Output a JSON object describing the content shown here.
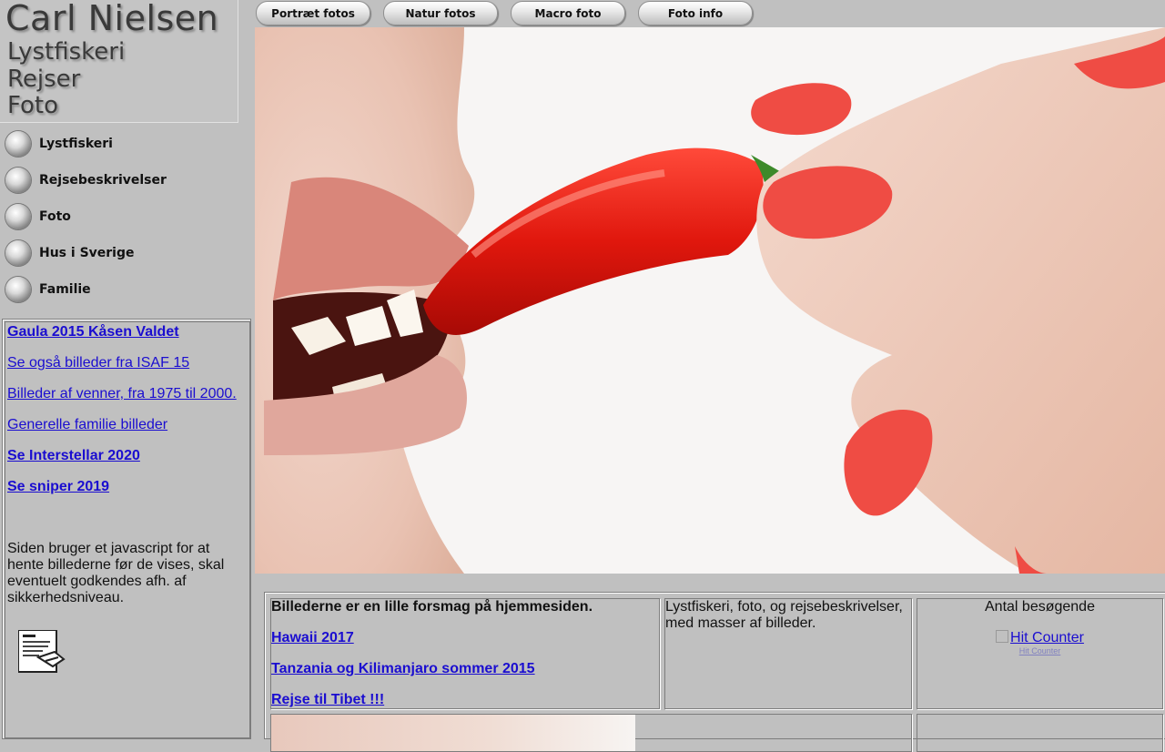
{
  "logo": {
    "title": "Carl Nielsen",
    "lines": [
      "Lystfiskeri",
      "Rejser",
      "Foto"
    ]
  },
  "top_nav": [
    "Portræt fotos",
    "Natur fotos",
    "Macro foto",
    "Foto info"
  ],
  "side_nav": [
    "Lystfiskeri",
    "Rejsebeskrivelser",
    "Foto",
    "Hus i Sverige",
    "Familie"
  ],
  "left_panel": {
    "links": [
      {
        "text": "Gaula 2015 Kåsen Valdet",
        "bold": true
      },
      {
        "text": "Se også billeder fra ISAF 15",
        "bold": false
      },
      {
        "text": "Billeder af venner, fra 1975 til 2000.",
        "bold": false
      },
      {
        "text": "Generelle familie billeder",
        "bold": false
      },
      {
        "text": "Se Interstellar 2020",
        "bold": true
      },
      {
        "text": "Se sniper 2019",
        "bold": true
      }
    ],
    "note": "Siden bruger et javascript for at hente billederne før de vises, skal eventuelt godkendes afh. af sikkerhedsniveau."
  },
  "hero": {
    "description_icon": "chili-pepper-photo"
  },
  "bottom": {
    "intro": "Billederne er en lille forsmag på hjemmesiden.",
    "links": [
      "Hawaii 2017",
      "Tanzania og Kilimanjaro sommer 2015",
      "Rejse til Tibet !!!"
    ],
    "description": "Lystfiskeri, foto, og rejsebeskrivelser, med masser af billeder.",
    "counter_label": "Antal besøgende",
    "counter_img_alt": "Hit Counter",
    "counter_link": "Hit Counter"
  },
  "colors": {
    "page_bg": "#c0c0c0",
    "link": "#1a0dd0"
  }
}
